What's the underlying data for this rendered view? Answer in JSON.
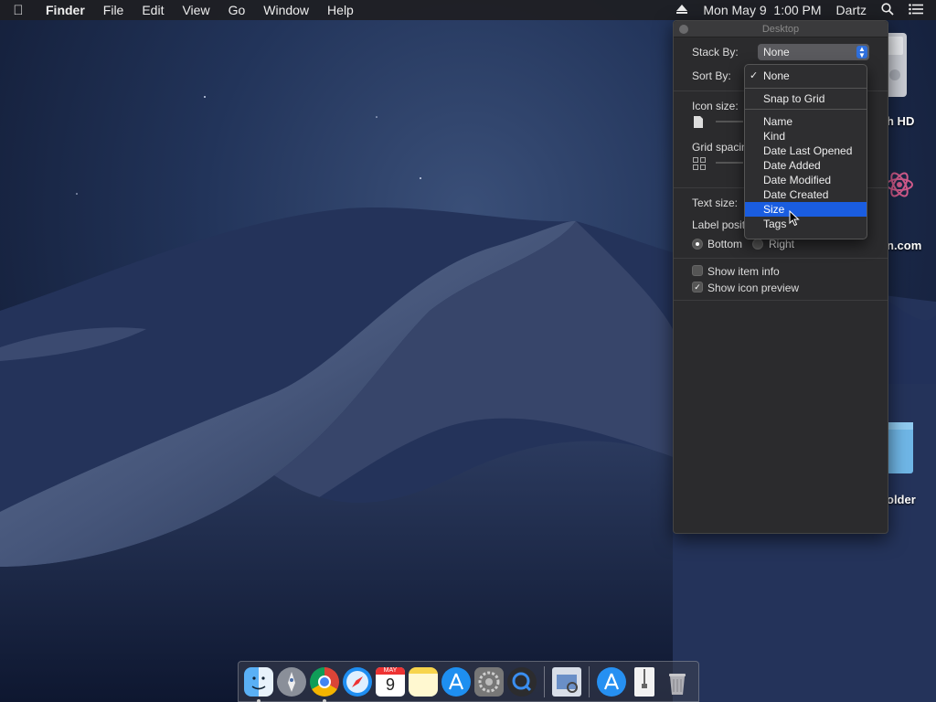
{
  "menubar": {
    "app_name": "Finder",
    "menus": [
      "File",
      "Edit",
      "View",
      "Go",
      "Window",
      "Help"
    ],
    "clock": "Mon May 9  1:00 PM",
    "user": "Dartz"
  },
  "desktop_icons": {
    "hd_label": "h HD",
    "app_label": "n.com",
    "folder_label": "older"
  },
  "panel": {
    "title": "Desktop",
    "stack_by_label": "Stack By:",
    "stack_by_value": "None",
    "sort_by_label": "Sort By:",
    "icon_size_label": "Icon size:",
    "grid_spacing_label": "Grid spacin",
    "text_size_label": "Text size:",
    "label_position_label": "Label positi",
    "bottom_label": "Bottom",
    "right_label": "Right",
    "show_item_info_label": "Show item info",
    "show_item_info_checked": false,
    "show_icon_preview_label": "Show icon preview",
    "show_icon_preview_checked": true
  },
  "sort_menu": {
    "checked_item": "None",
    "items": {
      "none": "None",
      "snap": "Snap to Grid",
      "name": "Name",
      "kind": "Kind",
      "date_last_opened": "Date Last Opened",
      "date_added": "Date Added",
      "date_modified": "Date Modified",
      "date_created": "Date Created",
      "size": "Size",
      "tags": "Tags"
    },
    "highlighted": "Size"
  },
  "dock": {
    "calendar_month": "MAY",
    "calendar_day": "9",
    "apps": [
      "finder",
      "launchpad",
      "chrome",
      "safari",
      "calendar",
      "notes",
      "app-store",
      "system-preferences",
      "quicktime",
      "preview",
      "app-store-2",
      "archive-utility",
      "trash"
    ]
  },
  "colors": {
    "selection": "#1a5de0",
    "panel_bg": "#2b2b2d"
  }
}
